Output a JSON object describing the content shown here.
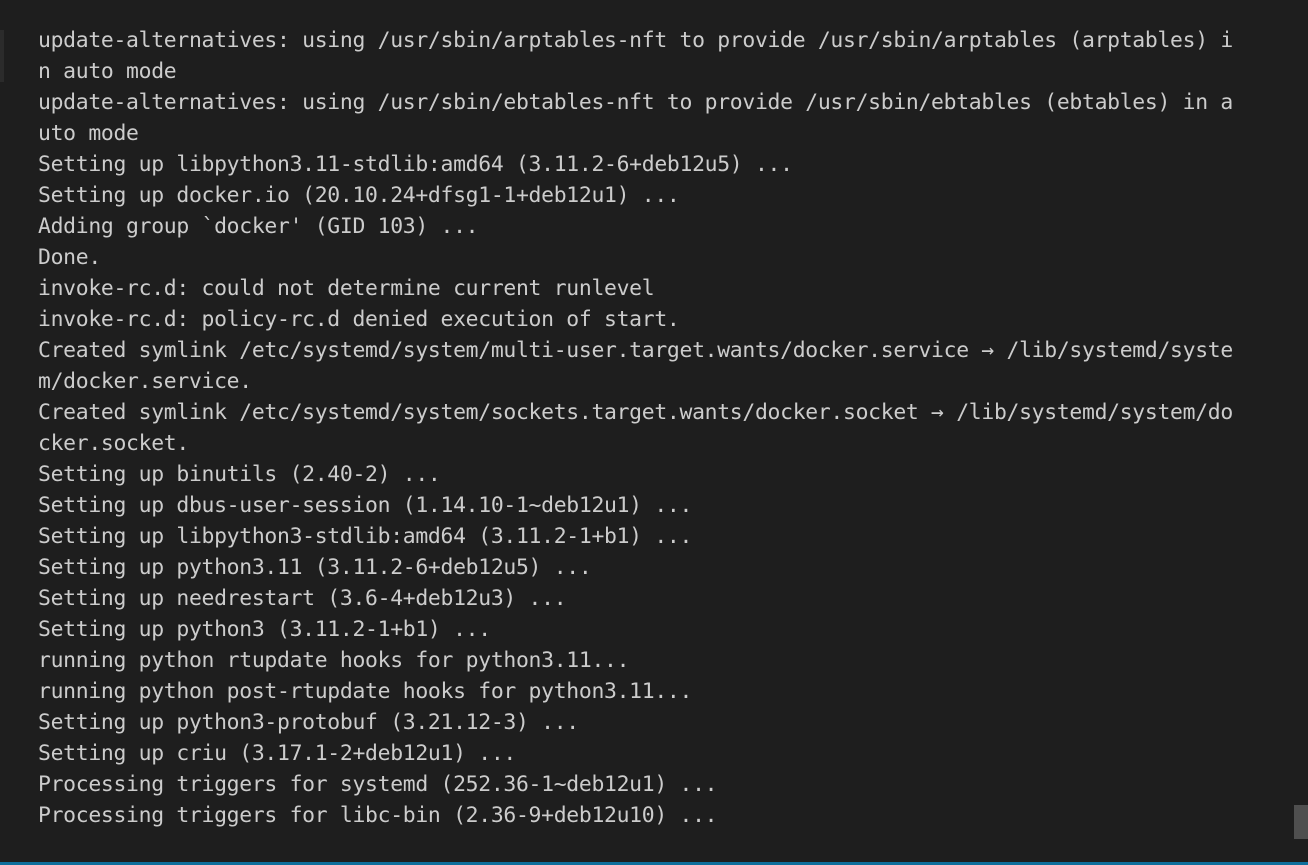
{
  "terminal": {
    "lines": [
      "update-alternatives: using /usr/sbin/arptables-nft to provide /usr/sbin/arptables (arptables) i",
      "n auto mode",
      "update-alternatives: using /usr/sbin/ebtables-nft to provide /usr/sbin/ebtables (ebtables) in a",
      "uto mode",
      "Setting up libpython3.11-stdlib:amd64 (3.11.2-6+deb12u5) ...",
      "Setting up docker.io (20.10.24+dfsg1-1+deb12u1) ...",
      "Adding group `docker' (GID 103) ...",
      "Done.",
      "invoke-rc.d: could not determine current runlevel",
      "invoke-rc.d: policy-rc.d denied execution of start.",
      "Created symlink /etc/systemd/system/multi-user.target.wants/docker.service → /lib/systemd/syste",
      "m/docker.service.",
      "Created symlink /etc/systemd/system/sockets.target.wants/docker.socket → /lib/systemd/system/do",
      "cker.socket.",
      "Setting up binutils (2.40-2) ...",
      "Setting up dbus-user-session (1.14.10-1~deb12u1) ...",
      "Setting up libpython3-stdlib:amd64 (3.11.2-1+b1) ...",
      "Setting up python3.11 (3.11.2-6+deb12u5) ...",
      "Setting up needrestart (3.6-4+deb12u3) ...",
      "Setting up python3 (3.11.2-1+b1) ...",
      "running python rtupdate hooks for python3.11...",
      "running python post-rtupdate hooks for python3.11...",
      "Setting up python3-protobuf (3.21.12-3) ...",
      "Setting up criu (3.17.1-2+deb12u1) ...",
      "Processing triggers for systemd (252.36-1~deb12u1) ...",
      "Processing triggers for libc-bin (2.36-9+deb12u10) ..."
    ]
  },
  "colors": {
    "background": "#1e1e1e",
    "text": "#cccccc",
    "accent": "#0e6f9c",
    "scroll_thumb": "#4f4f4f"
  }
}
